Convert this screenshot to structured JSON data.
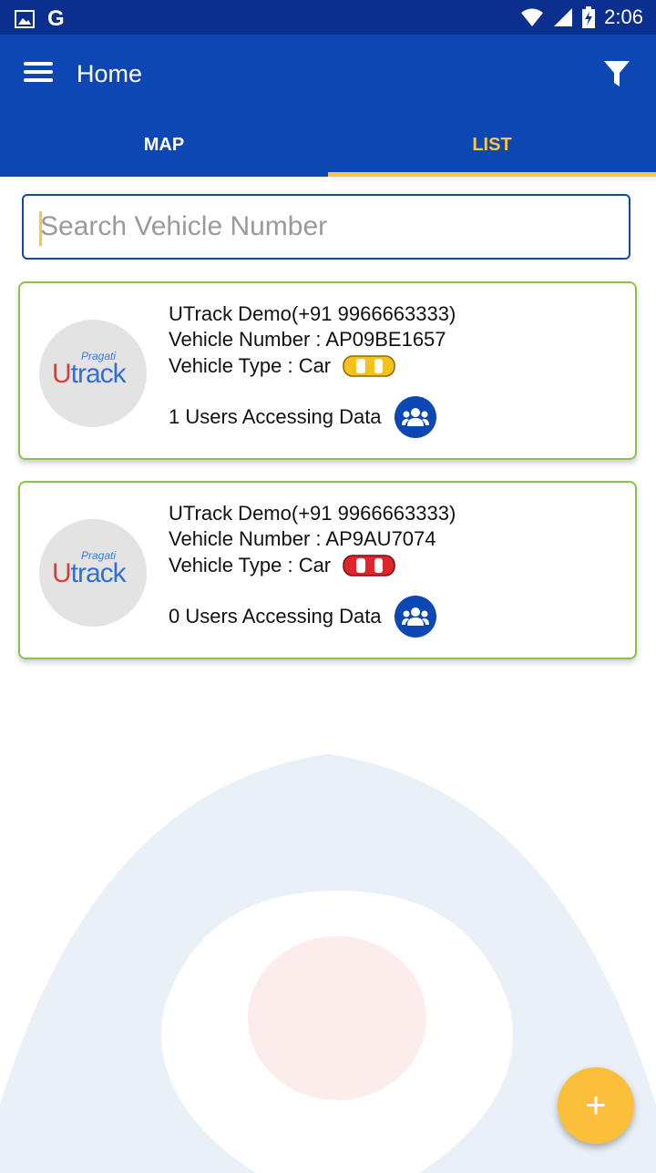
{
  "status_bar": {
    "time": "2:06"
  },
  "app_bar": {
    "title": "Home"
  },
  "tabs": [
    {
      "label": "MAP",
      "active": false
    },
    {
      "label": "LIST",
      "active": true
    }
  ],
  "search": {
    "placeholder": "Search Vehicle Number",
    "value": ""
  },
  "vehicles": [
    {
      "logo": {
        "sub": "Pragati",
        "main_first": "U",
        "main_rest": "track"
      },
      "owner": "UTrack Demo(+91 9966663333)",
      "number": "Vehicle Number : AP09BE1657",
      "type": "Vehicle Type : Car",
      "car_color": "#f5c21b",
      "users": "1 Users Accessing Data"
    },
    {
      "logo": {
        "sub": "Pragati",
        "main_first": "U",
        "main_rest": "track"
      },
      "owner": "UTrack Demo(+91 9966663333)",
      "number": "Vehicle Number : AP9AU7074",
      "type": "Vehicle Type : Car",
      "car_color": "#e0242b",
      "users": "0 Users Accessing Data"
    }
  ],
  "fab": {
    "label": "+"
  },
  "colors": {
    "primary": "#0d47b4",
    "status_bar": "#0b2f8f",
    "accent": "#f9c543",
    "card_border": "#8bc34a"
  }
}
